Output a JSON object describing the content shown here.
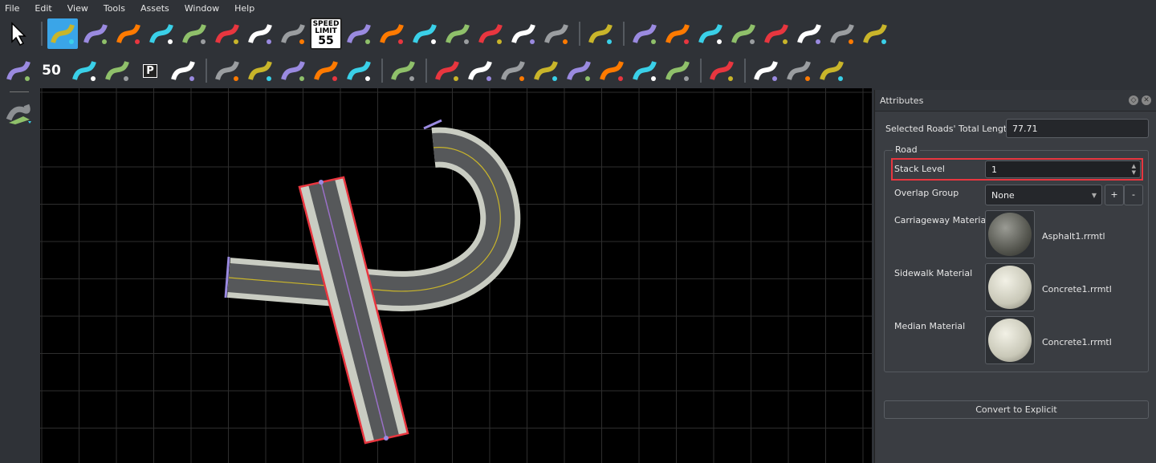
{
  "menu": [
    "File",
    "Edit",
    "View",
    "Tools",
    "Assets",
    "Window",
    "Help"
  ],
  "toolbar1": [
    "select-arrow-icon",
    "road-plan-icon",
    "roundabout-icon",
    "road-construction-icon",
    "road-elevation-icon",
    "road-rotate-icon",
    "lane-width-icon",
    "bridge-icon",
    "surface-map-icon",
    "speed-limit-sign-icon",
    "lane-add-icon",
    "lane-split-icon",
    "junction-add-icon",
    "junction-slip-icon",
    "junction-lanes-icon",
    "junction-curve-icon",
    "traffic-light-icon",
    "lane-direction-icon",
    "lane-width-tool-icon",
    "lane-add-tool-icon",
    "lane-elevation-icon",
    "lane-marking-insert-icon",
    "lane-marking-add-icon",
    "lane-cross-icon",
    "lane-marking-split-icon",
    "lane-marking-arrows-icon"
  ],
  "toolbar2": [
    "lane-marking-icon",
    "maneuver-icon",
    "spline-icon",
    "surface-icon",
    "parking-icon",
    "crosswalk-icon",
    "cone-icon",
    "prop-point-icon",
    "prop-polygon-icon",
    "prop-curve-icon",
    "sign-icon",
    "terrain-icon",
    "elevation-map-icon",
    "height-map-icon",
    "point-cloud-icon",
    "branch-icon",
    "layer-road-icon",
    "layer-spline-icon",
    "layer-point-icon",
    "layer-marker-icon",
    "measure-icon",
    "camera-icon",
    "road-visibility-icon",
    "terrain-visibility-icon"
  ],
  "speed_sign": {
    "top": "SPEED",
    "mid": "LIMIT",
    "num": "55"
  },
  "maneuver_num": "50",
  "parking_letter": "P",
  "panel": {
    "title": "Attributes",
    "total_length_label": "Selected Roads' Total Length",
    "total_length_value": "77.71",
    "group_title": "Road",
    "stack_level_label": "Stack Level",
    "stack_level_value": "1",
    "overlap_label": "Overlap Group",
    "overlap_value": "None",
    "add_label": "+",
    "remove_label": "-",
    "materials": [
      {
        "label": "Carriageway Material",
        "file": "Asphalt1.rrmtl"
      },
      {
        "label": "Sidewalk Material",
        "file": "Concrete1.rrmtl"
      },
      {
        "label": "Median Material",
        "file": "Concrete1.rrmtl"
      }
    ],
    "convert_label": "Convert to Explicit"
  },
  "colors": {
    "accent": "#3aa5e8",
    "highlight": "#e8363f",
    "selection": "#e8363f",
    "road_edge": "#c9ccc2",
    "asphalt": "#56585a"
  }
}
